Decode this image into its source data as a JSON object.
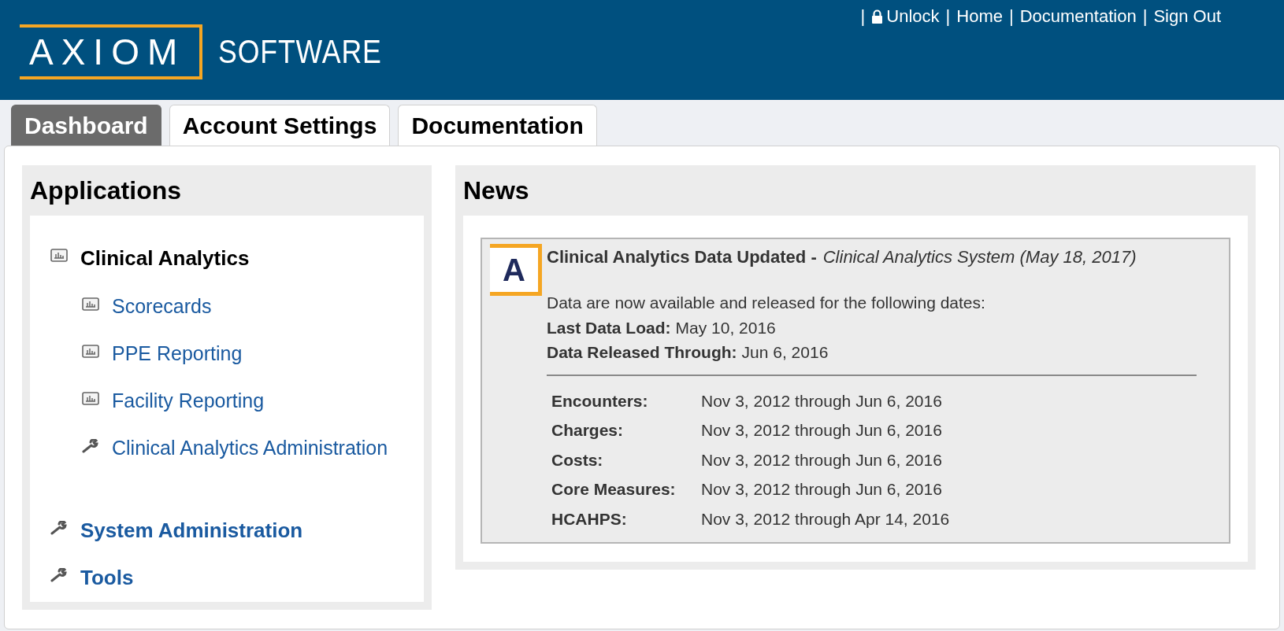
{
  "header": {
    "logo_main": "AXIOM",
    "logo_sub": "SOFTWARE",
    "top_links": [
      {
        "prefix": "|",
        "label": "Unlock",
        "kind": "lock"
      },
      {
        "prefix": "|",
        "label": "Home",
        "kind": "plain"
      },
      {
        "prefix": "|",
        "label": "Documentation",
        "kind": "plain"
      },
      {
        "prefix": "|",
        "label": "Sign Out",
        "kind": "plain"
      }
    ]
  },
  "tabs": [
    {
      "label": "Dashboard",
      "selected": true
    },
    {
      "label": "Account Settings",
      "selected": false
    },
    {
      "label": "Documentation",
      "selected": false
    }
  ],
  "applications": {
    "title": "Applications",
    "items": [
      {
        "label": "Clinical Analytics",
        "kind": "chart",
        "link": false,
        "children": [
          {
            "label": "Scorecards",
            "kind": "chart",
            "link": true
          },
          {
            "label": "PPE Reporting",
            "kind": "chart",
            "link": true
          },
          {
            "label": "Facility Reporting",
            "kind": "chart",
            "link": true
          },
          {
            "label": "Clinical Analytics Administration",
            "kind": "wrench",
            "link": true
          }
        ]
      },
      {
        "label": "System Administration",
        "kind": "wrench",
        "link": true
      },
      {
        "label": "Tools",
        "kind": "wrench",
        "link": true
      }
    ]
  },
  "news": {
    "title": "News",
    "items": [
      {
        "logo_letter": "A",
        "headline": "Clinical Analytics Data Updated -",
        "source": "Clinical Analytics System (May 18, 2017)",
        "intro": "Data are now available and released for the following dates:",
        "facts": [
          {
            "label": "Last Data Load:",
            "value": "May 10, 2016"
          },
          {
            "label": "Data Released Through:",
            "value": "Jun 6, 2016"
          }
        ],
        "rows": [
          {
            "label": "Encounters:",
            "value": "Nov 3, 2012 through Jun 6, 2016"
          },
          {
            "label": "Charges:",
            "value": "Nov 3, 2012 through Jun 6, 2016"
          },
          {
            "label": "Costs:",
            "value": "Nov 3, 2012 through Jun 6, 2016"
          },
          {
            "label": "Core Measures:",
            "value": "Nov 3, 2012 through Jun 6, 2016"
          },
          {
            "label": "HCAHPS:",
            "value": "Nov 3, 2012 through Apr 14, 2016"
          }
        ]
      }
    ]
  }
}
